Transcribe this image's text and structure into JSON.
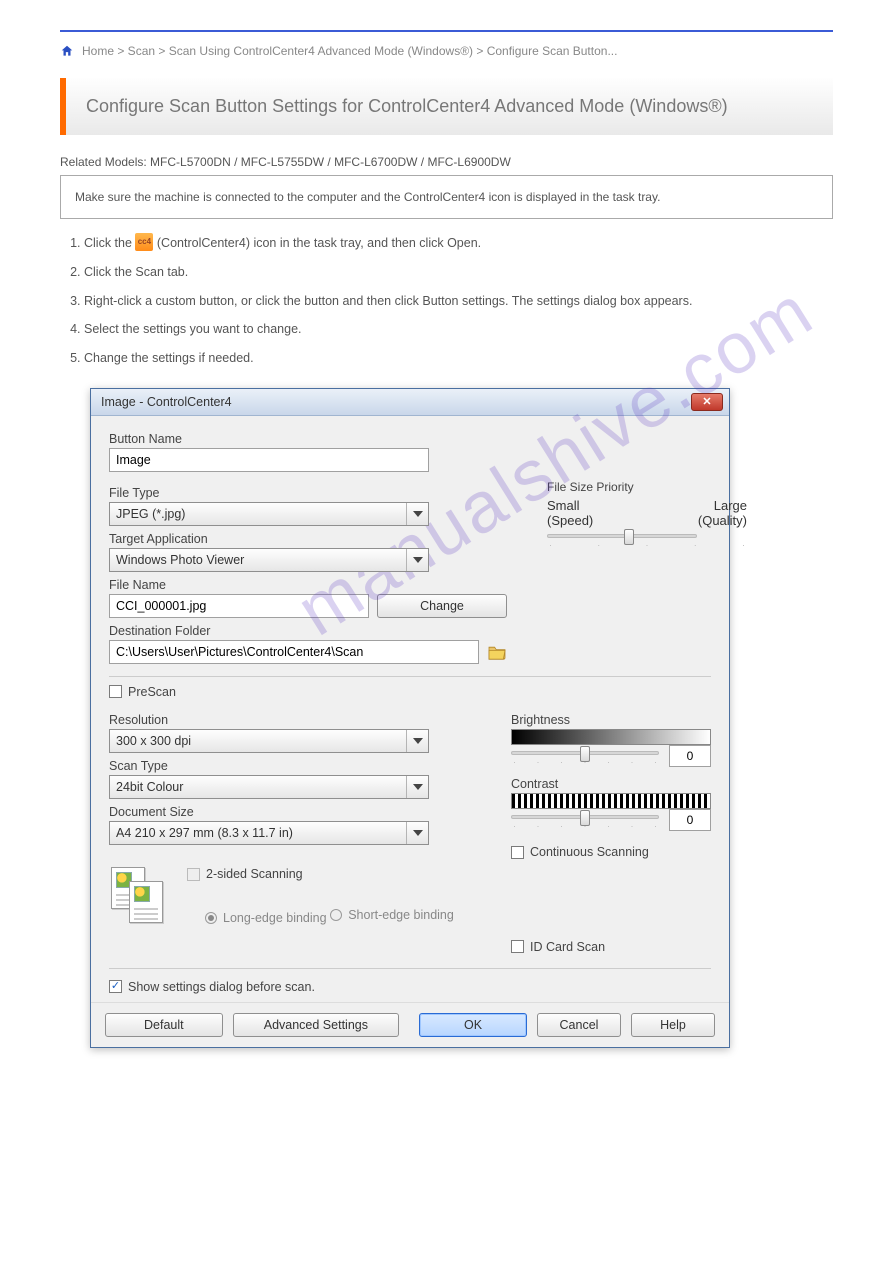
{
  "breadcrumb": "Home > Scan > Scan Using ControlCenter4 Advanced Mode (Windows®) > Configure Scan Button...",
  "page_title": "Configure Scan Button Settings for ControlCenter4 Advanced Mode (Windows®)",
  "related_models": "Related Models: MFC-L5700DN / MFC-L5755DW / MFC-L6700DW / MFC-L6900DW",
  "intro": "Make sure the machine is connected to the computer and the ControlCenter4 icon is displayed in the task tray.",
  "steps": {
    "s1a": "Click the ",
    "s1b": " (ControlCenter4) icon in the task tray, and then click Open.",
    "s2": "Click the Scan tab.",
    "s3": "Right-click a custom button, or click the button and then click Button settings. The settings dialog box appears.",
    "s4": "Select the settings you want to change.",
    "s5": "Change the settings if needed."
  },
  "dialog": {
    "title": "Image - ControlCenter4",
    "button_name_label": "Button Name",
    "button_name_value": "Image",
    "file_type_label": "File Type",
    "file_type_value": "JPEG (*.jpg)",
    "target_app_label": "Target Application",
    "target_app_value": "Windows Photo Viewer",
    "file_name_label": "File Name",
    "file_name_value": "CCI_000001.jpg",
    "change_btn": "Change",
    "dest_folder_label": "Destination Folder",
    "dest_folder_value": "C:\\Users\\User\\Pictures\\ControlCenter4\\Scan",
    "file_size_priority_label": "File Size Priority",
    "small_label": "Small",
    "large_label": "Large",
    "speed_label": "(Speed)",
    "quality_label": "(Quality)",
    "prescan_label": "PreScan",
    "resolution_label": "Resolution",
    "resolution_value": "300 x 300 dpi",
    "scan_type_label": "Scan Type",
    "scan_type_value": "24bit Colour",
    "doc_size_label": "Document Size",
    "doc_size_value": "A4 210 x 297 mm (8.3 x 11.7 in)",
    "brightness_label": "Brightness",
    "brightness_value": "0",
    "contrast_label": "Contrast",
    "contrast_value": "0",
    "continuous_label": "Continuous Scanning",
    "two_sided_label": "2-sided Scanning",
    "long_edge_label": "Long-edge binding",
    "short_edge_label": "Short-edge binding",
    "idcard_label": "ID Card Scan",
    "show_settings_label": "Show settings dialog before scan.",
    "default_btn": "Default",
    "advanced_btn": "Advanced Settings",
    "ok_btn": "OK",
    "cancel_btn": "Cancel",
    "help_btn": "Help"
  },
  "watermark": "manualshive.com"
}
